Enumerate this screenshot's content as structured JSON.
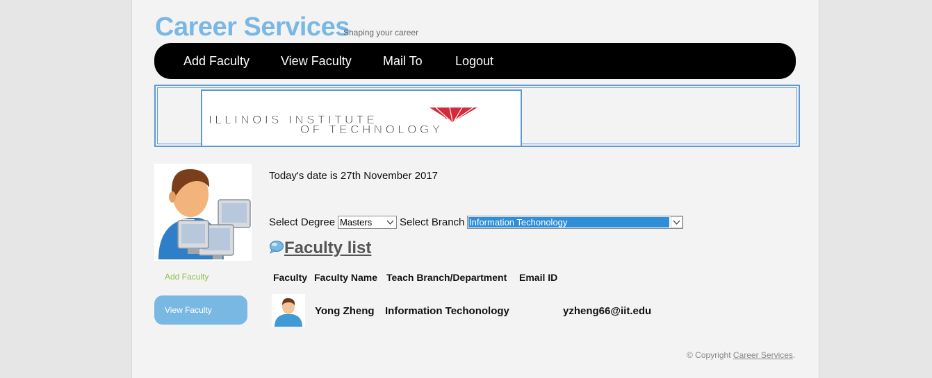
{
  "header": {
    "title": "Career Services",
    "tagline": "Shaping your career"
  },
  "nav": {
    "items": [
      {
        "label": "Add Faculty"
      },
      {
        "label": "View Faculty"
      },
      {
        "label": "Mail To"
      },
      {
        "label": "Logout"
      }
    ]
  },
  "banner": {
    "logo_line1": "ILLINOIS INSTITUTE",
    "logo_line2": "OF TECHNOLOGY",
    "logo_color": "#d42a3a"
  },
  "sidebar": {
    "avatar_icon": "user-computers-icon",
    "add_link": "Add Faculty",
    "view_button": "View Faculty"
  },
  "main": {
    "date_text": "Today's date is 27th November 2017",
    "degree_label": "Select Degree",
    "degree_value": "Masters",
    "branch_label": "Select Branch",
    "branch_value": "Information Techonology",
    "list_heading": "Faculty list",
    "list_icon": "speech-bubble-icon",
    "table": {
      "headers": [
        "Faculty",
        "Faculty Name",
        "Teach Branch/Department",
        "Email ID"
      ],
      "rows": [
        {
          "photo_icon": "user-icon",
          "name": "Yong Zheng",
          "branch": "Information Techonology",
          "email": "yzheng66@iit.edu"
        }
      ]
    }
  },
  "footer": {
    "prefix": "© Copyright",
    "link": "Career Services",
    "suffix": "."
  },
  "colors": {
    "accent": "#7ab8e4",
    "nav_bg": "#000000",
    "link_green": "#8cc34a",
    "select_highlight": "#2f8ed8"
  }
}
